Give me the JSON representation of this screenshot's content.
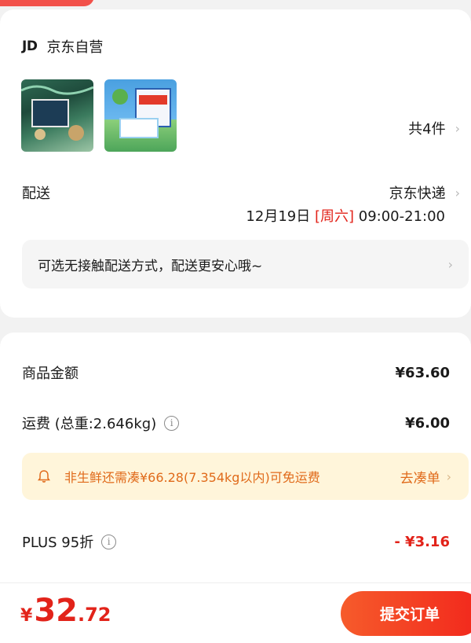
{
  "store": {
    "logo": "JD",
    "name": "京东自营"
  },
  "products": {
    "thumbnails": [
      "product-thumbnail-1",
      "product-thumbnail-2"
    ],
    "count_label": "共4件"
  },
  "delivery": {
    "label": "配送",
    "courier": "京东快递",
    "date": "12月19日",
    "weekday": "[周六]",
    "time_range": "09:00-21:00",
    "contactless_notice": "可选无接触配送方式，配送更安心哦~"
  },
  "summary": {
    "goods_label": "商品金额",
    "goods_value": "¥63.60",
    "shipping_label": "运费 (总重:2.646kg)",
    "shipping_value": "¥6.00",
    "free_shipping_notice": "非生鲜还需凑¥66.28(7.354kg以内)可免运费",
    "free_shipping_cta": "去凑单",
    "plus_label": "PLUS 95折",
    "plus_value": "- ¥3.16"
  },
  "footer": {
    "currency": "¥",
    "total_int": "32",
    "total_dec": ".72",
    "submit_label": "提交订单"
  },
  "colors": {
    "accent": "#e2231a",
    "notice_bg": "#fff5da",
    "notice_text": "#e06a1a"
  },
  "icons": {
    "chevron": "chevron-right-icon",
    "info": "info-icon",
    "bell": "bell-icon"
  }
}
